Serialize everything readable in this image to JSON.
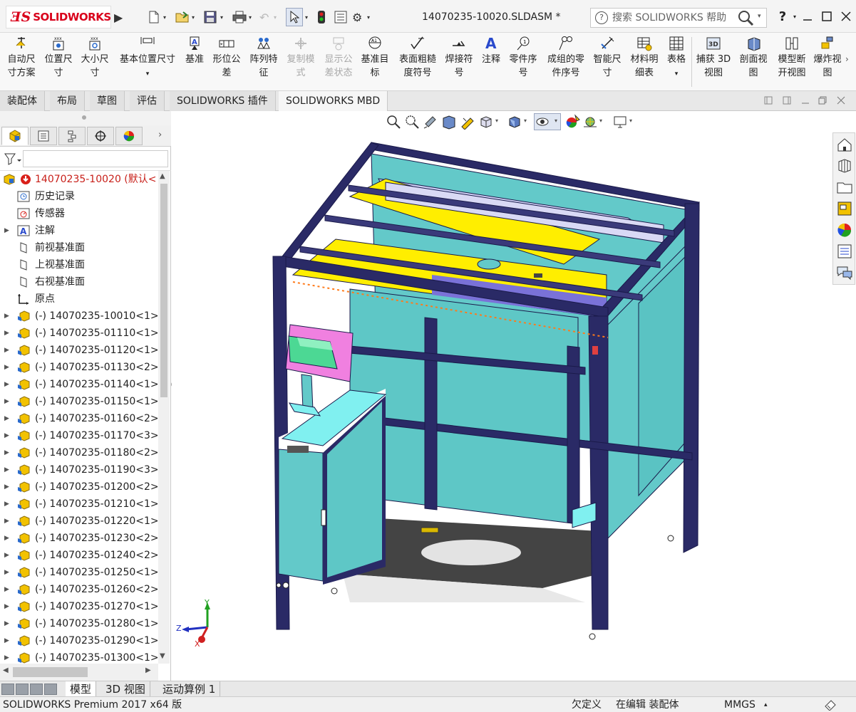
{
  "app": {
    "logo_text": "SOLIDWORKS",
    "doc_title": "14070235-10020.SLDASM *",
    "search_placeholder": "搜索 SOLIDWORKS 帮助",
    "help_label": "?"
  },
  "commands": [
    {
      "id": "auto-dim-scheme",
      "label1": "自动尺",
      "label2": "寸方案",
      "enabled": true
    },
    {
      "id": "location-dim",
      "label1": "位置尺",
      "label2": "寸",
      "enabled": true
    },
    {
      "id": "size-dim",
      "label1": "大小尺",
      "label2": "寸",
      "enabled": true
    },
    {
      "id": "basic-location-dim",
      "label1": "基本位置尺寸",
      "label2": "",
      "enabled": true
    },
    {
      "id": "datum",
      "label1": "基准",
      "label2": "",
      "enabled": true
    },
    {
      "id": "geo-tolerance",
      "label1": "形位公",
      "label2": "差",
      "enabled": true
    },
    {
      "id": "pattern-feature",
      "label1": "阵列特",
      "label2": "征",
      "enabled": true
    },
    {
      "id": "copy-scheme",
      "label1": "复制模",
      "label2": "式",
      "enabled": false
    },
    {
      "id": "show-tolerance",
      "label1": "显示公",
      "label2": "差状态",
      "enabled": false
    },
    {
      "id": "datum-target",
      "label1": "基准目",
      "label2": "标",
      "enabled": true
    },
    {
      "id": "surface-finish",
      "label1": "表面粗糙",
      "label2": "度符号",
      "enabled": true
    },
    {
      "id": "weld-symbol",
      "label1": "焊接符",
      "label2": "号",
      "enabled": true
    },
    {
      "id": "note",
      "label1": "注释",
      "label2": "",
      "enabled": true
    },
    {
      "id": "balloon",
      "label1": "零件序",
      "label2": "号",
      "enabled": true
    },
    {
      "id": "stacked-balloon",
      "label1": "成组的零",
      "label2": "件序号",
      "enabled": true
    },
    {
      "id": "smart-dim",
      "label1": "智能尺",
      "label2": "寸",
      "enabled": true
    },
    {
      "id": "bom",
      "label1": "材料明",
      "label2": "细表",
      "enabled": true
    },
    {
      "id": "table",
      "label1": "表格",
      "label2": "",
      "enabled": true
    },
    {
      "id": "capture-3d-view",
      "label1": "捕获 3D",
      "label2": "视图",
      "enabled": true
    },
    {
      "id": "section-view",
      "label1": "剖面视",
      "label2": "图",
      "enabled": true
    },
    {
      "id": "model-break-view",
      "label1": "模型断",
      "label2": "开视图",
      "enabled": true
    },
    {
      "id": "explode-view",
      "label1": "爆炸视",
      "label2": "图",
      "enabled": true
    }
  ],
  "tabs": [
    "装配体",
    "布局",
    "草图",
    "评估",
    "SOLIDWORKS 插件",
    "SOLIDWORKS MBD"
  ],
  "active_tab": "SOLIDWORKS MBD",
  "tree": {
    "root": "14070235-10020 (默认<",
    "fixed_items": [
      "历史记录",
      "传感器",
      "注解",
      "前视基准面",
      "上视基准面",
      "右视基准面",
      "原点"
    ],
    "components": [
      "(-) 14070235-10010<1>",
      "(-) 14070235-01110<1>",
      "(-) 14070235-01120<1>",
      "(-) 14070235-01130<2>",
      "(-) 14070235-01140<1>",
      "(-) 14070235-01150<1>",
      "(-) 14070235-01160<2>",
      "(-) 14070235-01170<3>",
      "(-) 14070235-01180<2>",
      "(-) 14070235-01190<3>",
      "(-) 14070235-01200<2>",
      "(-) 14070235-01210<1>",
      "(-) 14070235-01220<1>",
      "(-) 14070235-01230<2>",
      "(-) 14070235-01240<2>",
      "(-) 14070235-01250<1>",
      "(-) 14070235-01260<2>",
      "(-) 14070235-01270<1>",
      "(-) 14070235-01280<1>",
      "(-) 14070235-01290<1>",
      "(-) 14070235-01300<1>"
    ]
  },
  "triad": {
    "y": "Y",
    "z": "Z",
    "x": "X"
  },
  "bottom_tabs": [
    "模型",
    "3D 视图",
    "运动算例 1"
  ],
  "active_bottom_tab": "模型",
  "status": {
    "product": "SOLIDWORKS Premium 2017 x64 版",
    "definition": "欠定义",
    "editing": "在编辑 装配体",
    "units": "MMGS"
  },
  "colors": {
    "teal_panel": "#66cccc",
    "frame_navy": "#2a2a66",
    "yellow_plate": "#ffee00",
    "lavender": "#c8c8f0",
    "brand_red": "#d9001b"
  }
}
